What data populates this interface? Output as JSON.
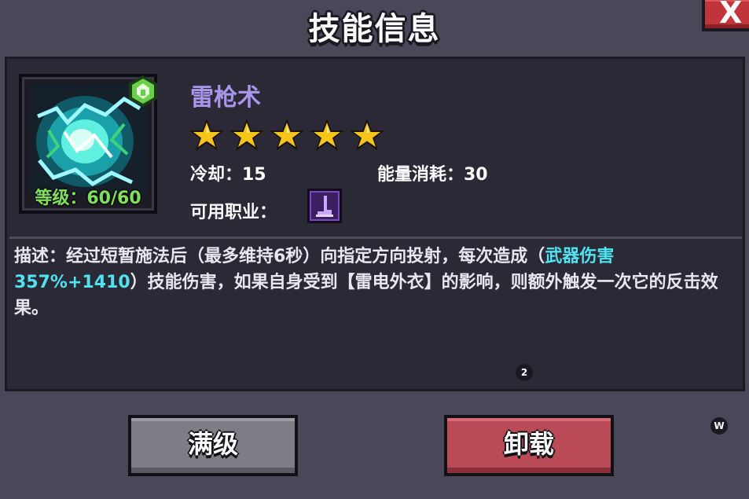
{
  "header": {
    "title": "技能信息",
    "close_label": "X"
  },
  "skill": {
    "name": "雷枪术",
    "level_label": "等级：60/60",
    "stars": 5,
    "cooldown_label": "冷却：15",
    "energy_label": "能量消耗：30",
    "class_label": "可用职业：",
    "icon_name": "thunder-spear-skill-icon",
    "badge_icon": "green-gem-icon",
    "class_icon": "mage-class-icon"
  },
  "description": {
    "part1": "描述：经过短暂施法后（最多维持6秒）向指定方向投射，每次造成（",
    "highlight": "武器伤害357%+1410",
    "part2": "）技能伤害，如果自身受到【雷电外衣】的影响，则额外触发一次它的反击效果。"
  },
  "indicators": {
    "page": "2",
    "corner": "W"
  },
  "buttons": {
    "max_level": "满级",
    "unload": "卸载"
  },
  "colors": {
    "skill_name": "#a995ea",
    "level_text": "#7fe05a",
    "highlight": "#4fe3f0",
    "star": "#f5c518",
    "btn_max": "#7e7d86",
    "btn_unload": "#b94a56",
    "close": "#c0343a"
  }
}
